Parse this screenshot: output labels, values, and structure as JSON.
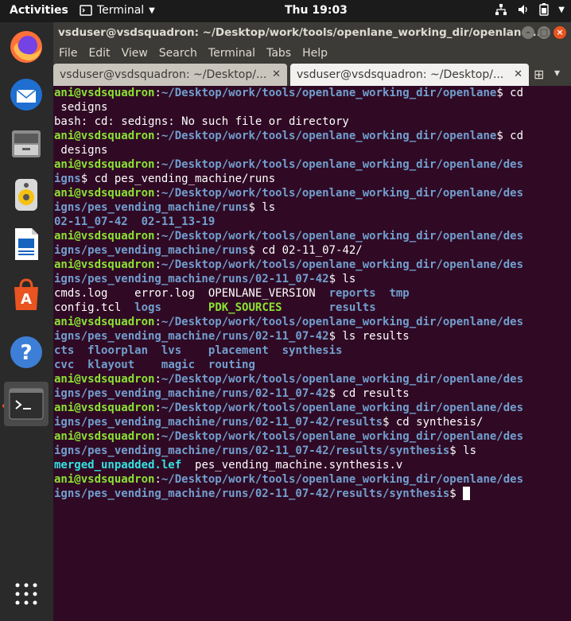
{
  "topbar": {
    "activities": "Activities",
    "app": "Terminal",
    "clock": "Thu 19:03"
  },
  "dock": {
    "items": [
      "firefox-icon",
      "thunderbird-icon",
      "files-icon",
      "rhythmbox-icon",
      "writer-icon",
      "software-icon",
      "help-icon",
      "terminal-icon"
    ]
  },
  "window": {
    "title": "vsduser@vsdsquadron: ~/Desktop/work/tools/openlane_working_dir/openlane/...",
    "menu": [
      "File",
      "Edit",
      "View",
      "Search",
      "Terminal",
      "Tabs",
      "Help"
    ],
    "tabs": [
      {
        "label": "vsduser@vsdsquadron: ~/Desktop/..."
      },
      {
        "label": "vsduser@vsdsquadron: ~/Desktop/..."
      }
    ]
  },
  "terminal": {
    "lines": [
      [
        {
          "t": "ani@vsdsquadron",
          "s": "g"
        },
        {
          "t": ":",
          "s": ""
        },
        {
          "t": "~/Desktop/work/tools/openlane_working_dir/openlane",
          "s": "b"
        },
        {
          "t": "$ cd",
          "s": ""
        }
      ],
      [
        {
          "t": " sedigns",
          "s": ""
        }
      ],
      [
        {
          "t": "bash: cd: sedigns: No such file or directory",
          "s": ""
        }
      ],
      [
        {
          "t": "ani@vsdsquadron",
          "s": "g"
        },
        {
          "t": ":",
          "s": ""
        },
        {
          "t": "~/Desktop/work/tools/openlane_working_dir/openlane",
          "s": "b"
        },
        {
          "t": "$ cd",
          "s": ""
        }
      ],
      [
        {
          "t": " designs",
          "s": ""
        }
      ],
      [
        {
          "t": "ani@vsdsquadron",
          "s": "g"
        },
        {
          "t": ":",
          "s": ""
        },
        {
          "t": "~/Desktop/work/tools/openlane_working_dir/openlane/des",
          "s": "b"
        }
      ],
      [
        {
          "t": "igns",
          "s": "b"
        },
        {
          "t": "$ cd pes_vending_machine/runs",
          "s": ""
        }
      ],
      [
        {
          "t": "ani@vsdsquadron",
          "s": "g"
        },
        {
          "t": ":",
          "s": ""
        },
        {
          "t": "~/Desktop/work/tools/openlane_working_dir/openlane/des",
          "s": "b"
        }
      ],
      [
        {
          "t": "igns/pes_vending_machine/runs",
          "s": "b"
        },
        {
          "t": "$ ls",
          "s": ""
        }
      ],
      [
        {
          "t": "02-11_07-42  02-11_13-19",
          "s": "b"
        }
      ],
      [
        {
          "t": "ani@vsdsquadron",
          "s": "g"
        },
        {
          "t": ":",
          "s": ""
        },
        {
          "t": "~/Desktop/work/tools/openlane_working_dir/openlane/des",
          "s": "b"
        }
      ],
      [
        {
          "t": "igns/pes_vending_machine/runs",
          "s": "b"
        },
        {
          "t": "$ cd 02-11_07-42/",
          "s": ""
        }
      ],
      [
        {
          "t": "ani@vsdsquadron",
          "s": "g"
        },
        {
          "t": ":",
          "s": ""
        },
        {
          "t": "~/Desktop/work/tools/openlane_working_dir/openlane/des",
          "s": "b"
        }
      ],
      [
        {
          "t": "igns/pes_vending_machine/runs/02-11_07-42",
          "s": "b"
        },
        {
          "t": "$ ls",
          "s": ""
        }
      ],
      [
        {
          "t": "cmds.log    error.log  OPENLANE_VERSION  ",
          "s": ""
        },
        {
          "t": "reports",
          "s": "b"
        },
        {
          "t": "  ",
          "s": ""
        },
        {
          "t": "tmp",
          "s": "b"
        }
      ],
      [
        {
          "t": "config.tcl  ",
          "s": ""
        },
        {
          "t": "logs",
          "s": "b"
        },
        {
          "t": "       ",
          "s": ""
        },
        {
          "t": "PDK_SOURCES",
          "s": "g"
        },
        {
          "t": "       ",
          "s": ""
        },
        {
          "t": "results",
          "s": "b"
        }
      ],
      [
        {
          "t": "ani@vsdsquadron",
          "s": "g"
        },
        {
          "t": ":",
          "s": ""
        },
        {
          "t": "~/Desktop/work/tools/openlane_working_dir/openlane/des",
          "s": "b"
        }
      ],
      [
        {
          "t": "igns/pes_vending_machine/runs/02-11_07-42",
          "s": "b"
        },
        {
          "t": "$ ls results",
          "s": ""
        }
      ],
      [
        {
          "t": "cts",
          "s": "b"
        },
        {
          "t": "  ",
          "s": ""
        },
        {
          "t": "floorplan",
          "s": "b"
        },
        {
          "t": "  ",
          "s": ""
        },
        {
          "t": "lvs",
          "s": "b"
        },
        {
          "t": "    ",
          "s": ""
        },
        {
          "t": "placement",
          "s": "b"
        },
        {
          "t": "  ",
          "s": ""
        },
        {
          "t": "synthesis",
          "s": "b"
        }
      ],
      [
        {
          "t": "cvc",
          "s": "b"
        },
        {
          "t": "  ",
          "s": ""
        },
        {
          "t": "klayout",
          "s": "b"
        },
        {
          "t": "    ",
          "s": ""
        },
        {
          "t": "magic",
          "s": "b"
        },
        {
          "t": "  ",
          "s": ""
        },
        {
          "t": "routing",
          "s": "b"
        }
      ],
      [
        {
          "t": "ani@vsdsquadron",
          "s": "g"
        },
        {
          "t": ":",
          "s": ""
        },
        {
          "t": "~/Desktop/work/tools/openlane_working_dir/openlane/des",
          "s": "b"
        }
      ],
      [
        {
          "t": "igns/pes_vending_machine/runs/02-11_07-42",
          "s": "b"
        },
        {
          "t": "$ cd results",
          "s": ""
        }
      ],
      [
        {
          "t": "ani@vsdsquadron",
          "s": "g"
        },
        {
          "t": ":",
          "s": ""
        },
        {
          "t": "~/Desktop/work/tools/openlane_working_dir/openlane/des",
          "s": "b"
        }
      ],
      [
        {
          "t": "igns/pes_vending_machine/runs/02-11_07-42/results",
          "s": "b"
        },
        {
          "t": "$ cd synthesis/",
          "s": ""
        }
      ],
      [
        {
          "t": "ani@vsdsquadron",
          "s": "g"
        },
        {
          "t": ":",
          "s": ""
        },
        {
          "t": "~/Desktop/work/tools/openlane_working_dir/openlane/des",
          "s": "b"
        }
      ],
      [
        {
          "t": "igns/pes_vending_machine/runs/02-11_07-42/results/synthesis",
          "s": "b"
        },
        {
          "t": "$ ls",
          "s": ""
        }
      ],
      [
        {
          "t": "merged_unpadded.lef",
          "s": "c"
        },
        {
          "t": "  pes_vending_machine.synthesis.v",
          "s": ""
        }
      ],
      [
        {
          "t": "ani@vsdsquadron",
          "s": "g"
        },
        {
          "t": ":",
          "s": ""
        },
        {
          "t": "~/Desktop/work/tools/openlane_working_dir/openlane/des",
          "s": "b"
        }
      ],
      [
        {
          "t": "igns/pes_vending_machine/runs/02-11_07-42/results/synthesis",
          "s": "b"
        },
        {
          "t": "$ ",
          "s": ""
        }
      ]
    ]
  },
  "colors": {
    "prompt_user": "#8ae234",
    "prompt_path": "#729fcf",
    "terminal_bg": "#300a24",
    "accent": "#e95420"
  }
}
